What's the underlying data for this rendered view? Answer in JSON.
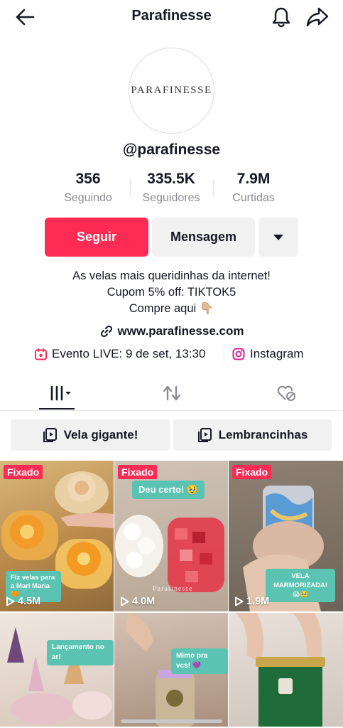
{
  "header": {
    "title": "Parafinesse"
  },
  "profile": {
    "avatar_text": "PARAFINESSE",
    "handle": "@parafinesse",
    "stats": [
      {
        "value": "356",
        "label": "Seguindo"
      },
      {
        "value": "335.5K",
        "label": "Seguidores"
      },
      {
        "value": "7.9M",
        "label": "Curtidas"
      }
    ],
    "buttons": {
      "follow": "Seguir",
      "message": "Mensagem"
    },
    "bio": [
      "As velas mais queridinhas da internet!",
      "Cupom 5% off: TIKTOK5",
      "Compre aqui 👇🏼"
    ],
    "link": "www.parafinesse.com",
    "event": "Evento LIVE: 9 de set, 13:30",
    "instagram": "Instagram"
  },
  "playlists": [
    "Vela gigante!",
    "Lembrancinhas"
  ],
  "videos": [
    {
      "pinned": "Fixado",
      "views": "4.5M",
      "caption": "Fiz velas para a Mari Maria 🧡"
    },
    {
      "pinned": "Fixado",
      "views": "4.0M",
      "caption": "Deu certo! 🥹",
      "watermark": "Parafinesse"
    },
    {
      "pinned": "Fixado",
      "views": "1.9M",
      "caption": "VELA MARMORIZADA! 😱🥹"
    },
    {
      "caption": "Lançamento no ar!"
    },
    {
      "caption": "Mimo pra vcs! 💜"
    },
    {}
  ],
  "colors": {
    "accent": "#fe2c55",
    "secondary_button": "#f1f1f2",
    "caption_bubble": "#5ac3b2"
  }
}
